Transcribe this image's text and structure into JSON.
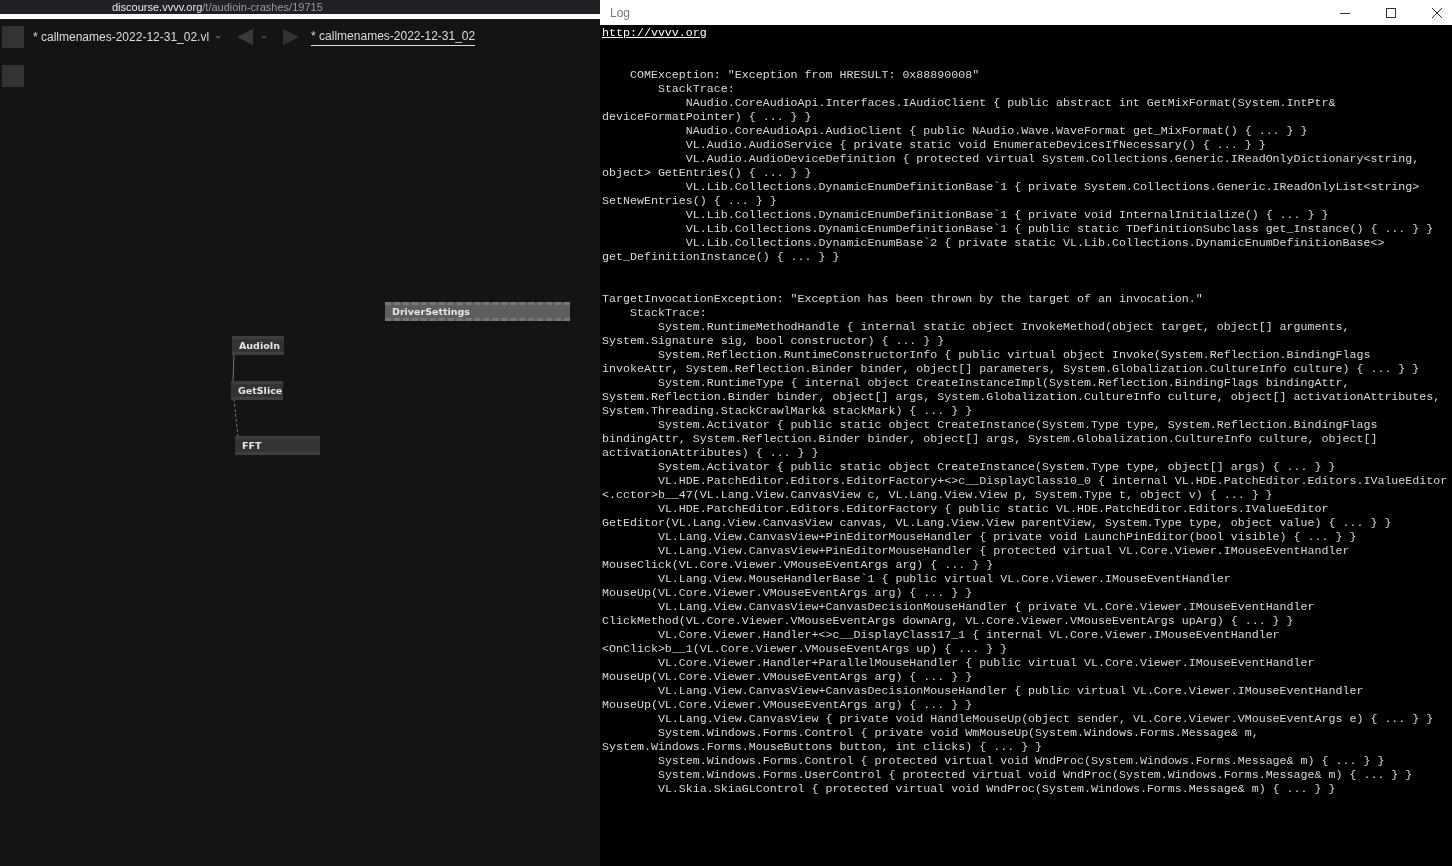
{
  "browser": {
    "url_host": "discourse.vvvv.org",
    "url_path": "/t/audioin-crashes/19715"
  },
  "editor": {
    "document_tab": "* callmenames-2022-12-31_02.vl",
    "breadcrumb": "* callmenames-2022-12-31_02",
    "nodes": [
      {
        "label": "DriverSettings",
        "kind": "iobox"
      },
      {
        "label": "AudioIn",
        "kind": "node"
      },
      {
        "label": "GetSlice",
        "kind": "node"
      },
      {
        "label": "FFT",
        "kind": "node"
      }
    ]
  },
  "log_window": {
    "title": "Log",
    "link": "http://vvvv.org",
    "exceptions": [
      {
        "header": "    COMException: \"Exception from HRESULT: 0x88890008\"",
        "stack_label": "        StackTrace:",
        "frames": [
          "            NAudio.CoreAudioApi.Interfaces.IAudioClient { public abstract int GetMixFormat(System.IntPtr& deviceFormatPointer) { ... } }",
          "            NAudio.CoreAudioApi.AudioClient { public NAudio.Wave.WaveFormat get_MixFormat() { ... } }",
          "            VL.Audio.AudioService { private static void EnumerateDevicesIfNecessary() { ... } }",
          "            VL.Audio.AudioDeviceDefinition { protected virtual System.Collections.Generic.IReadOnlyDictionary<string, object> GetEntries() { ... } }",
          "            VL.Lib.Collections.DynamicEnumDefinitionBase`1 { private System.Collections.Generic.IReadOnlyList<string> SetNewEntries() { ... } }",
          "            VL.Lib.Collections.DynamicEnumDefinitionBase`1 { private void InternalInitialize() { ... } }",
          "            VL.Lib.Collections.DynamicEnumDefinitionBase`1 { public static TDefinitionSubclass get_Instance() { ... } }",
          "            VL.Lib.Collections.DynamicEnumBase`2 { private static VL.Lib.Collections.DynamicEnumDefinitionBase<> get_DefinitionInstance() { ... } }"
        ]
      },
      {
        "header": "TargetInvocationException: \"Exception has been thrown by the target of an invocation.\"",
        "stack_label": "    StackTrace:",
        "frames": [
          "        System.RuntimeMethodHandle { internal static object InvokeMethod(object target, object[] arguments, System.Signature sig, bool constructor) { ... } }",
          "        System.Reflection.RuntimeConstructorInfo { public virtual object Invoke(System.Reflection.BindingFlags invokeAttr, System.Reflection.Binder binder, object[] parameters, System.Globalization.CultureInfo culture) { ... } }",
          "        System.RuntimeType { internal object CreateInstanceImpl(System.Reflection.BindingFlags bindingAttr, System.Reflection.Binder binder, object[] args, System.Globalization.CultureInfo culture, object[] activationAttributes, System.Threading.StackCrawlMark& stackMark) { ... } }",
          "        System.Activator { public static object CreateInstance(System.Type type, System.Reflection.BindingFlags bindingAttr, System.Reflection.Binder binder, object[] args, System.Globalization.CultureInfo culture, object[] activationAttributes) { ... } }",
          "        System.Activator { public static object CreateInstance(System.Type type, object[] args) { ... } }",
          "        VL.HDE.PatchEditor.Editors.EditorFactory+<>c__DisplayClass10_0 { internal VL.HDE.PatchEditor.Editors.IValueEditor <.cctor>b__47(VL.Lang.View.CanvasView c, VL.Lang.View.View p, System.Type t, object v) { ... } }",
          "        VL.HDE.PatchEditor.Editors.EditorFactory { public static VL.HDE.PatchEditor.Editors.IValueEditor GetEditor(VL.Lang.View.CanvasView canvas, VL.Lang.View.View parentView, System.Type type, object value) { ... } }",
          "        VL.Lang.View.CanvasView+PinEditorMouseHandler { private void LaunchPinEditor(bool visible) { ... } }",
          "        VL.Lang.View.CanvasView+PinEditorMouseHandler { protected virtual VL.Core.Viewer.IMouseEventHandler MouseClick(VL.Core.Viewer.VMouseEventArgs arg) { ... } }",
          "        VL.Lang.View.MouseHandlerBase`1 { public virtual VL.Core.Viewer.IMouseEventHandler MouseUp(VL.Core.Viewer.VMouseEventArgs arg) { ... } }",
          "        VL.Lang.View.CanvasView+CanvasDecisionMouseHandler { private VL.Core.Viewer.IMouseEventHandler ClickMethod(VL.Core.Viewer.VMouseEventArgs downArg, VL.Core.Viewer.VMouseEventArgs upArg) { ... } }",
          "        VL.Core.Viewer.Handler+<>c__DisplayClass17_1 { internal VL.Core.Viewer.IMouseEventHandler <OnClick>b__1(VL.Core.Viewer.VMouseEventArgs up) { ... } }",
          "        VL.Core.Viewer.Handler+ParallelMouseHandler { public virtual VL.Core.Viewer.IMouseEventHandler MouseUp(VL.Core.Viewer.VMouseEventArgs arg) { ... } }",
          "        VL.Lang.View.CanvasView+CanvasDecisionMouseHandler { public virtual VL.Core.Viewer.IMouseEventHandler MouseUp(VL.Core.Viewer.VMouseEventArgs arg) { ... } }",
          "        VL.Lang.View.CanvasView { private void HandleMouseUp(object sender, VL.Core.Viewer.VMouseEventArgs e) { ... } }",
          "        System.Windows.Forms.Control { private void WmMouseUp(System.Windows.Forms.Message& m, System.Windows.Forms.MouseButtons button, int clicks) { ... } }",
          "        System.Windows.Forms.Control { protected virtual void WndProc(System.Windows.Forms.Message& m) { ... } }",
          "        System.Windows.Forms.UserControl { protected virtual void WndProc(System.Windows.Forms.Message& m) { ... } }",
          "        VL.Skia.SkiaGLControl { protected virtual void WndProc(System.Windows.Forms.Message& m) { ... } }"
        ]
      }
    ]
  }
}
